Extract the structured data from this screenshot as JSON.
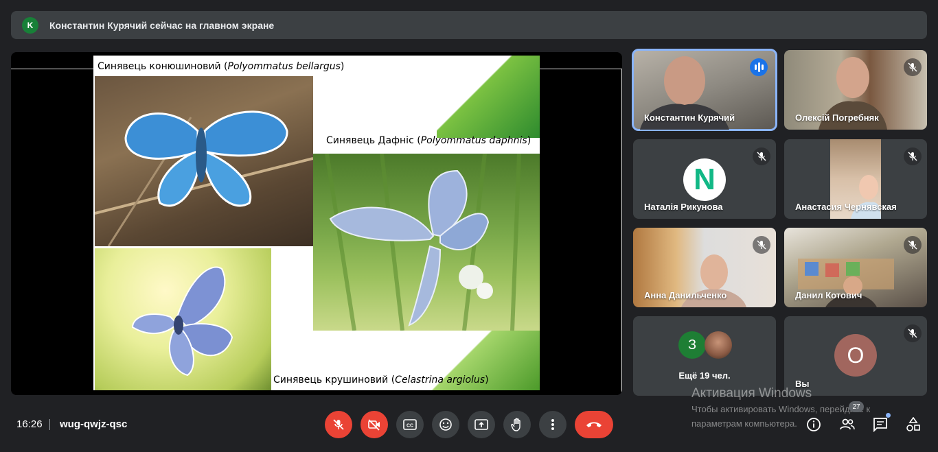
{
  "banner": {
    "avatar_letter": "K",
    "text": "Константин Курячий сейчас на главном экране"
  },
  "slide": {
    "caption1_main": "Синявець конюшиновий (",
    "caption1_latin": "Polyommatus bellargus",
    "caption1_end": ")",
    "caption2_main": "Синявець Дафніс (",
    "caption2_latin": "Polyommatus daphnis",
    "caption2_end": ")",
    "caption3_main": "Синявець крушиновий (",
    "caption3_latin": "Celastrina argiolus",
    "caption3_end": ")"
  },
  "participants": [
    {
      "name": "Константин Курячий",
      "state": "speaking",
      "type": "video"
    },
    {
      "name": "Олексій Погребняк",
      "state": "muted",
      "type": "video"
    },
    {
      "name": "Наталія Рикунова",
      "state": "muted",
      "type": "logo",
      "logo_letter": "N"
    },
    {
      "name": "Анастасия Чернявская",
      "state": "muted",
      "type": "video"
    },
    {
      "name": "Анна Данильченко",
      "state": "muted",
      "type": "video"
    },
    {
      "name": "Данил Котович",
      "state": "muted",
      "type": "video"
    }
  ],
  "more_tile": {
    "badge_letter": "З",
    "label": "Ещё 19 чел."
  },
  "self_tile": {
    "initial": "О",
    "name": "Вы",
    "state": "muted"
  },
  "controls": {
    "time": "16:26",
    "meeting_code": "wug-qwjz-qsc",
    "people_count": "27"
  },
  "watermark": {
    "title": "Активация Windows",
    "line": "Чтобы активировать Windows, перейдите к параметрам компьютера."
  },
  "colors": {
    "accent": "#1a73e8",
    "danger": "#ea4335",
    "tile": "#3c4043",
    "bg": "#202124"
  }
}
